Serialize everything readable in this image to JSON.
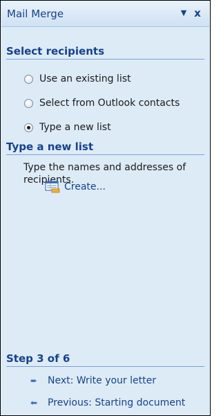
{
  "pane": {
    "title": "Mail Merge",
    "dropdown_glyph": "▼",
    "close_glyph": "x"
  },
  "select_recipients": {
    "heading": "Select recipients",
    "options": [
      {
        "label": "Use an existing list",
        "checked": false
      },
      {
        "label": "Select from Outlook contacts",
        "checked": false
      },
      {
        "label": "Type a new list",
        "checked": true
      }
    ]
  },
  "type_new_list": {
    "heading": "Type a new list",
    "description": "Type the names and addresses of recipients.",
    "create_link": "Create..."
  },
  "step": {
    "heading": "Step 3 of 6",
    "next_link": "Next: Write your letter",
    "previous_link": "Previous: Starting document",
    "next_icon": "arrow-right-icon",
    "previous_icon": "arrow-left-icon"
  },
  "colors": {
    "pane_background": "#ddebf7",
    "heading_text": "#15428b",
    "rule": "#7aa1d5"
  }
}
